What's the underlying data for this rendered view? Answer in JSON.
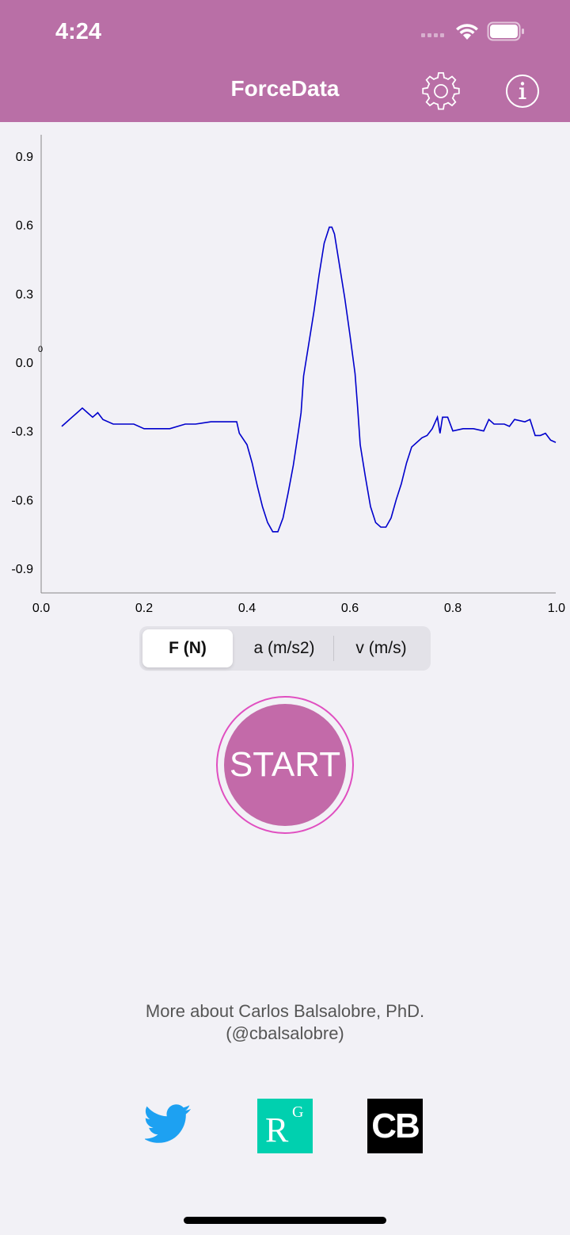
{
  "status_bar": {
    "time": "4:24"
  },
  "header": {
    "title": "ForceData",
    "settings_icon": "gear-icon",
    "info_icon": "info-icon",
    "background": "#b96fa6"
  },
  "chart_data": {
    "type": "line",
    "series_color": "#0000cc",
    "xlim": [
      0.0,
      1.0
    ],
    "ylim": [
      -1.0,
      1.0
    ],
    "x_ticks": [
      "0.0",
      "0.2",
      "0.4",
      "0.6",
      "0.8",
      "1.0"
    ],
    "y_ticks": [
      "0.9",
      "0.6",
      "0.3",
      "0.0",
      "-0.3",
      "-0.6",
      "-0.9"
    ],
    "y_ticks_values": [
      0.9,
      0.6,
      0.3,
      0.0,
      -0.3,
      -0.6,
      -0.9
    ],
    "x_ticks_values": [
      0.0,
      0.2,
      0.4,
      0.6,
      0.8,
      1.0
    ],
    "ylabel": "0",
    "grid": false,
    "series": [
      {
        "points": [
          [
            0.04,
            -0.28
          ],
          [
            0.05,
            -0.26
          ],
          [
            0.06,
            -0.24
          ],
          [
            0.07,
            -0.22
          ],
          [
            0.08,
            -0.2
          ],
          [
            0.09,
            -0.22
          ],
          [
            0.1,
            -0.24
          ],
          [
            0.11,
            -0.22
          ],
          [
            0.12,
            -0.25
          ],
          [
            0.14,
            -0.27
          ],
          [
            0.18,
            -0.27
          ],
          [
            0.2,
            -0.29
          ],
          [
            0.25,
            -0.29
          ],
          [
            0.28,
            -0.27
          ],
          [
            0.3,
            -0.27
          ],
          [
            0.33,
            -0.26
          ],
          [
            0.35,
            -0.26
          ],
          [
            0.36,
            -0.26
          ],
          [
            0.38,
            -0.26
          ],
          [
            0.385,
            -0.31
          ],
          [
            0.4,
            -0.36
          ],
          [
            0.41,
            -0.44
          ],
          [
            0.42,
            -0.54
          ],
          [
            0.43,
            -0.63
          ],
          [
            0.44,
            -0.7
          ],
          [
            0.45,
            -0.74
          ],
          [
            0.46,
            -0.74
          ],
          [
            0.47,
            -0.68
          ],
          [
            0.48,
            -0.57
          ],
          [
            0.49,
            -0.45
          ],
          [
            0.5,
            -0.3
          ],
          [
            0.505,
            -0.22
          ],
          [
            0.51,
            -0.06
          ],
          [
            0.52,
            0.08
          ],
          [
            0.53,
            0.22
          ],
          [
            0.54,
            0.38
          ],
          [
            0.55,
            0.52
          ],
          [
            0.56,
            0.59
          ],
          [
            0.565,
            0.59
          ],
          [
            0.57,
            0.56
          ],
          [
            0.58,
            0.42
          ],
          [
            0.59,
            0.28
          ],
          [
            0.6,
            0.12
          ],
          [
            0.61,
            -0.05
          ],
          [
            0.615,
            -0.2
          ],
          [
            0.62,
            -0.36
          ],
          [
            0.63,
            -0.5
          ],
          [
            0.64,
            -0.63
          ],
          [
            0.65,
            -0.7
          ],
          [
            0.66,
            -0.72
          ],
          [
            0.67,
            -0.72
          ],
          [
            0.68,
            -0.68
          ],
          [
            0.69,
            -0.6
          ],
          [
            0.7,
            -0.53
          ],
          [
            0.71,
            -0.44
          ],
          [
            0.72,
            -0.37
          ],
          [
            0.73,
            -0.35
          ],
          [
            0.74,
            -0.33
          ],
          [
            0.75,
            -0.32
          ],
          [
            0.76,
            -0.29
          ],
          [
            0.77,
            -0.24
          ],
          [
            0.775,
            -0.31
          ],
          [
            0.78,
            -0.24
          ],
          [
            0.79,
            -0.24
          ],
          [
            0.8,
            -0.3
          ],
          [
            0.82,
            -0.29
          ],
          [
            0.84,
            -0.29
          ],
          [
            0.86,
            -0.3
          ],
          [
            0.87,
            -0.25
          ],
          [
            0.88,
            -0.27
          ],
          [
            0.9,
            -0.27
          ],
          [
            0.91,
            -0.28
          ],
          [
            0.92,
            -0.25
          ],
          [
            0.94,
            -0.26
          ],
          [
            0.95,
            -0.25
          ],
          [
            0.96,
            -0.32
          ],
          [
            0.97,
            -0.32
          ],
          [
            0.98,
            -0.31
          ],
          [
            0.99,
            -0.34
          ],
          [
            1.0,
            -0.35
          ]
        ]
      }
    ]
  },
  "segmented_control": {
    "items": [
      "F (N)",
      "a (m/s2)",
      "v (m/s)"
    ],
    "selected": 0
  },
  "start_button": {
    "label": "START",
    "color": "#c36aa9",
    "ring_color": "#e04fc0"
  },
  "about": {
    "line1": "More about Carlos Balsalobre, PhD.",
    "line2": "(@cbalsalobre)"
  },
  "social": {
    "twitter_icon": "twitter-bird-icon",
    "researchgate": {
      "r": "R",
      "g": "G",
      "color": "#00d0af"
    },
    "cb": {
      "label": "CB"
    }
  }
}
